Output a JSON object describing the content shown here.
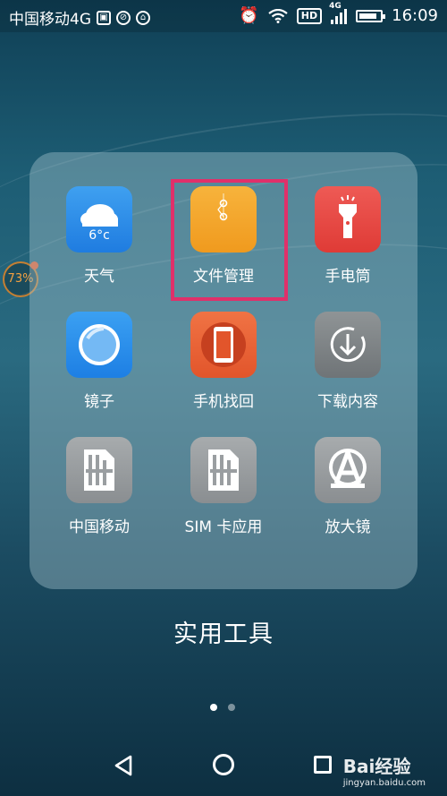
{
  "status_bar": {
    "carrier": "中国移动4G",
    "network_badge": "HD",
    "network_type": "4G",
    "time": "16:09",
    "battery_level_fraction": 0.85,
    "icons": [
      "image-icon",
      "blocked-icon",
      "shield-icon",
      "alarm-icon",
      "wifi-icon",
      "hd-icon",
      "signal-icon",
      "battery-icon"
    ]
  },
  "side_widget": {
    "percent": "73%"
  },
  "folder": {
    "title": "实用工具",
    "apps": [
      {
        "label": "天气",
        "icon": "weather-cloud-icon",
        "icon_text": "6°c",
        "color": "#2f8ee8"
      },
      {
        "label": "文件管理",
        "icon": "document-folder-icon",
        "color": "#f4a52a"
      },
      {
        "label": "手电筒",
        "icon": "flashlight-icon",
        "color": "#e5453f"
      },
      {
        "label": "镜子",
        "icon": "mirror-icon",
        "color": "#2b8fec"
      },
      {
        "label": "手机找回",
        "icon": "phone-finder-icon",
        "color": "#ea6434"
      },
      {
        "label": "下载内容",
        "icon": "download-icon",
        "color": "#7e8386"
      },
      {
        "label": "中国移动",
        "icon": "sim-card-icon",
        "color": "#9a9ea1"
      },
      {
        "label": "SIM 卡应用",
        "icon": "sim-card-icon",
        "color": "#9a9ea1"
      },
      {
        "label": "放大镜",
        "icon": "magnifier-icon",
        "color": "#9a9ea1"
      }
    ],
    "highlighted_app": "文件管理",
    "highlight_color": "#e0306a",
    "page_indicator": {
      "pages": 2,
      "current": 1
    }
  },
  "nav_bar": {
    "buttons": [
      "back-icon",
      "home-icon",
      "recent-apps-icon"
    ]
  },
  "watermark": {
    "brand": "Bai经验",
    "site": "jingyan.baidu.com"
  }
}
